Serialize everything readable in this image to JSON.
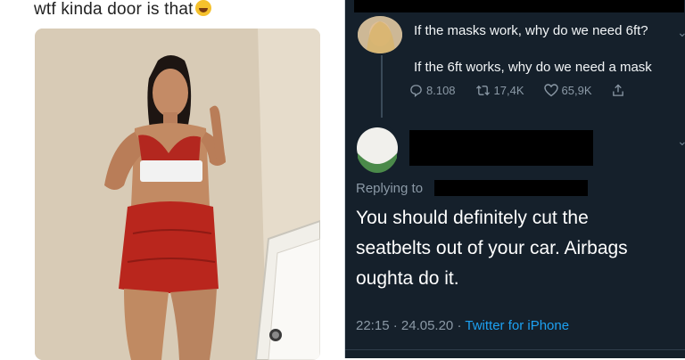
{
  "left": {
    "caption": "wtf kinda door is that",
    "caption_emoji": "laughing-emoji"
  },
  "tweet": {
    "quoted": {
      "line1": "If the masks work, why do we need 6ft?",
      "line2": "If the 6ft works, why do we need a mask",
      "replies": "8.108",
      "retweets": "17,4K",
      "likes": "65,9K"
    },
    "replying_label": "Replying to",
    "body": "You should definitely cut the seatbelts out of your car. Airbags oughta do it.",
    "time": "22:15",
    "date": "24.05.20",
    "sep": "·",
    "source": "Twitter for iPhone"
  },
  "colors": {
    "tweet_bg": "#15202b",
    "link": "#1da1f2",
    "muted": "#8b99a6"
  }
}
